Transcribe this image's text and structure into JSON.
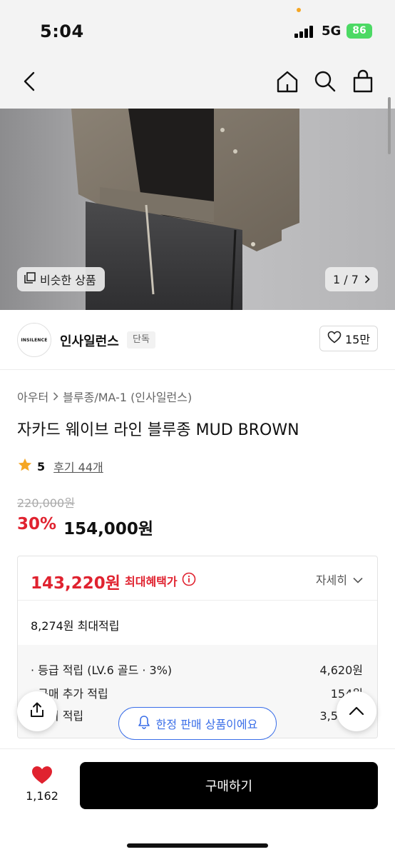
{
  "status_bar": {
    "time": "5:04",
    "network": "5G",
    "battery": "86"
  },
  "nav": {
    "back_icon": "chevron-left-icon",
    "home_icon": "home-icon",
    "search_icon": "search-icon",
    "cart_icon": "shopping-bag-icon"
  },
  "hero": {
    "similar_label": "비슷한 상품",
    "page_indicator": "1 / 7"
  },
  "brand": {
    "logo_text": "INSILENCE",
    "name": "인사일런스",
    "badge": "단독",
    "like_count": "15만"
  },
  "product": {
    "breadcrumb": [
      "아우터",
      "블루종/MA-1 (인사일런스)"
    ],
    "title": "자카드 웨이브 라인 블루종 MUD BROWN",
    "rating": "5",
    "reviews": "후기 44개",
    "original_price": "220,000원",
    "discount": "30%",
    "price": "154,000원"
  },
  "benefit": {
    "max_price": "143,220원",
    "max_label": "최대혜택가",
    "detail_label": "자세히",
    "total_points": "8,274원 최대적립",
    "rows": [
      {
        "label": "· 등급 적립 (LV.6 골드 · 3%)",
        "value": "4,620원"
      },
      {
        "label": "· 구매 추가 적립",
        "value": "154원"
      },
      {
        "label": "· 후기 적립",
        "value": "3,500원"
      }
    ]
  },
  "floating": {
    "limited_label": "한정 판매 상품이에요"
  },
  "bottom": {
    "heart_count": "1,162",
    "buy_label": "구매하기"
  },
  "colors": {
    "accent_red": "#e0222f",
    "toast_blue": "#3a6ee8",
    "battery_green": "#4cd964",
    "star": "#f5a623"
  }
}
